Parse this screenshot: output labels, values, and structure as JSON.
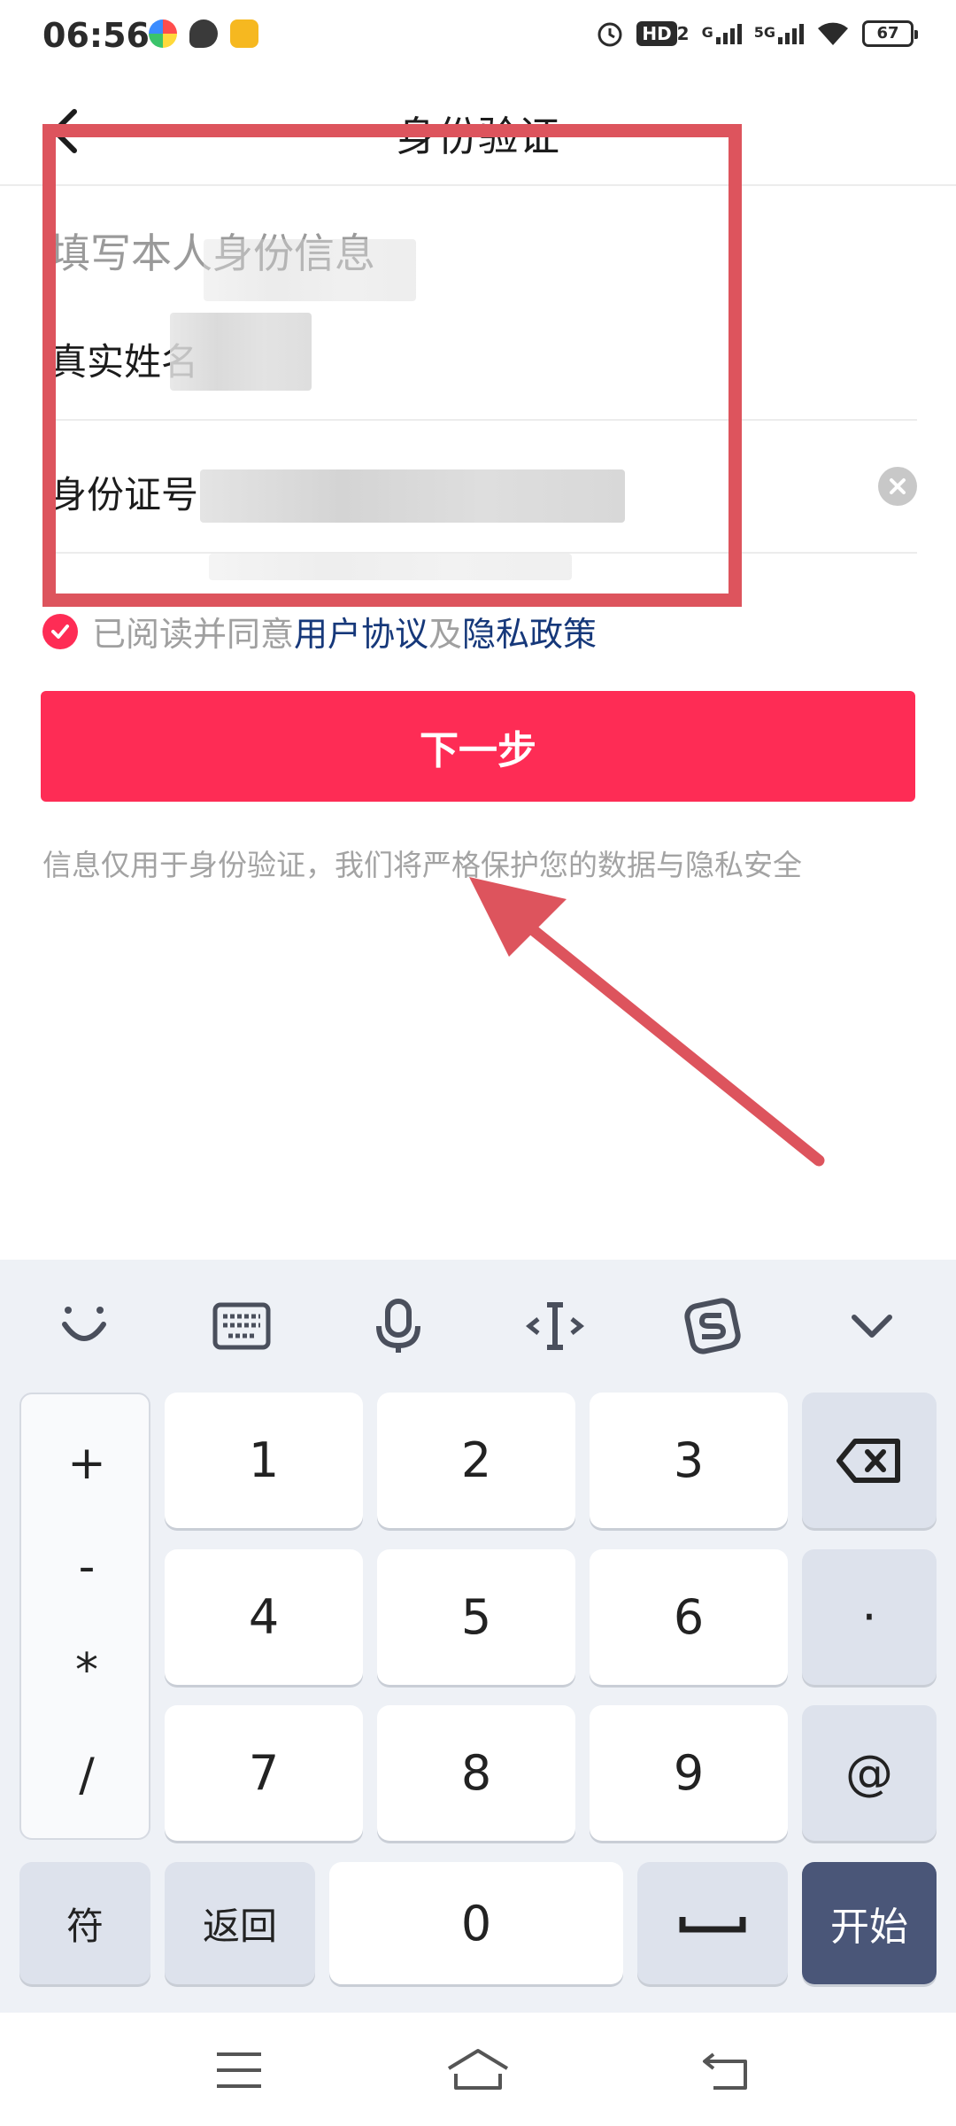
{
  "status_bar": {
    "time": "06:56",
    "hd_label": "HD",
    "hd_sub": "2",
    "net1": "G",
    "net2": "5G",
    "battery": "67"
  },
  "header": {
    "title": "身份验证"
  },
  "form": {
    "section_title": "填写本人身份信息",
    "name_label": "真实姓名",
    "id_label": "身份证号"
  },
  "agreement": {
    "prefix": "已阅读并同意",
    "user_agreement": "用户协议",
    "conjunction": "及",
    "privacy_policy": "隐私政策"
  },
  "next_button": "下一步",
  "privacy_note": "信息仅用于身份验证，我们将严格保护您的数据与隐私安全",
  "keyboard": {
    "symbols": [
      "+",
      "-",
      "*",
      "/"
    ],
    "digits": [
      "1",
      "2",
      "3",
      "4",
      "5",
      "6",
      "7",
      "8",
      "9",
      "0"
    ],
    "dot_key": "·",
    "at_key": "@",
    "symbols_key": "符",
    "back_key": "返回",
    "start_key": "开始"
  },
  "colors": {
    "accent": "#fe2c55",
    "link": "#16387a",
    "annotation": "#dd545d",
    "start_key": "#4a5678"
  }
}
